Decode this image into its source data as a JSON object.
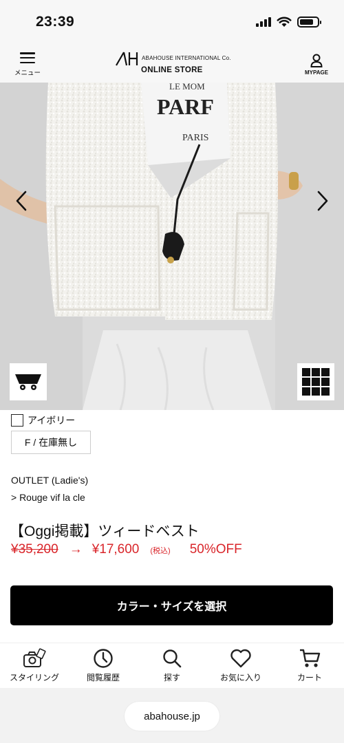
{
  "status_bar": {
    "time": "23:39"
  },
  "header": {
    "menu_label": "メニュー",
    "logo_sub": "ABAHOUSE INTERNATIONAL Co.",
    "logo_store": "ONLINE STORE",
    "mypage_label": "MYPAGE"
  },
  "product_image": {
    "shirt_text_1": "LE MOM",
    "shirt_text_2": "PARF",
    "shirt_text_3": "PARIS",
    "prev_icon": "chevron-left-icon",
    "next_icon": "chevron-right-icon",
    "cart_icon": "cart-icon",
    "grid_icon": "grid-icon"
  },
  "product": {
    "color": "アイボリー",
    "size_stock": "F / 在庫無し",
    "category_line1": "OUTLET (Ladie's)",
    "category_line2": "> Rouge vif la cle",
    "title": "【Oggi掲載】ツィードベスト",
    "price_old": "¥35,200",
    "price_arrow": "→",
    "price_new": "¥17,600",
    "price_tax": "(税込)",
    "price_off": "50%OFF",
    "sale_color": "#d9252a"
  },
  "select_button": {
    "label": "カラー・サイズを選択"
  },
  "bottom_nav": {
    "items": [
      {
        "label": "スタイリング",
        "icon": "camera-icon"
      },
      {
        "label": "閲覧履歴",
        "icon": "clock-icon"
      },
      {
        "label": "探す",
        "icon": "search-icon"
      },
      {
        "label": "お気に入り",
        "icon": "heart-icon"
      },
      {
        "label": "カート",
        "icon": "cart-icon"
      }
    ]
  },
  "browser": {
    "url": "abahouse.jp"
  }
}
